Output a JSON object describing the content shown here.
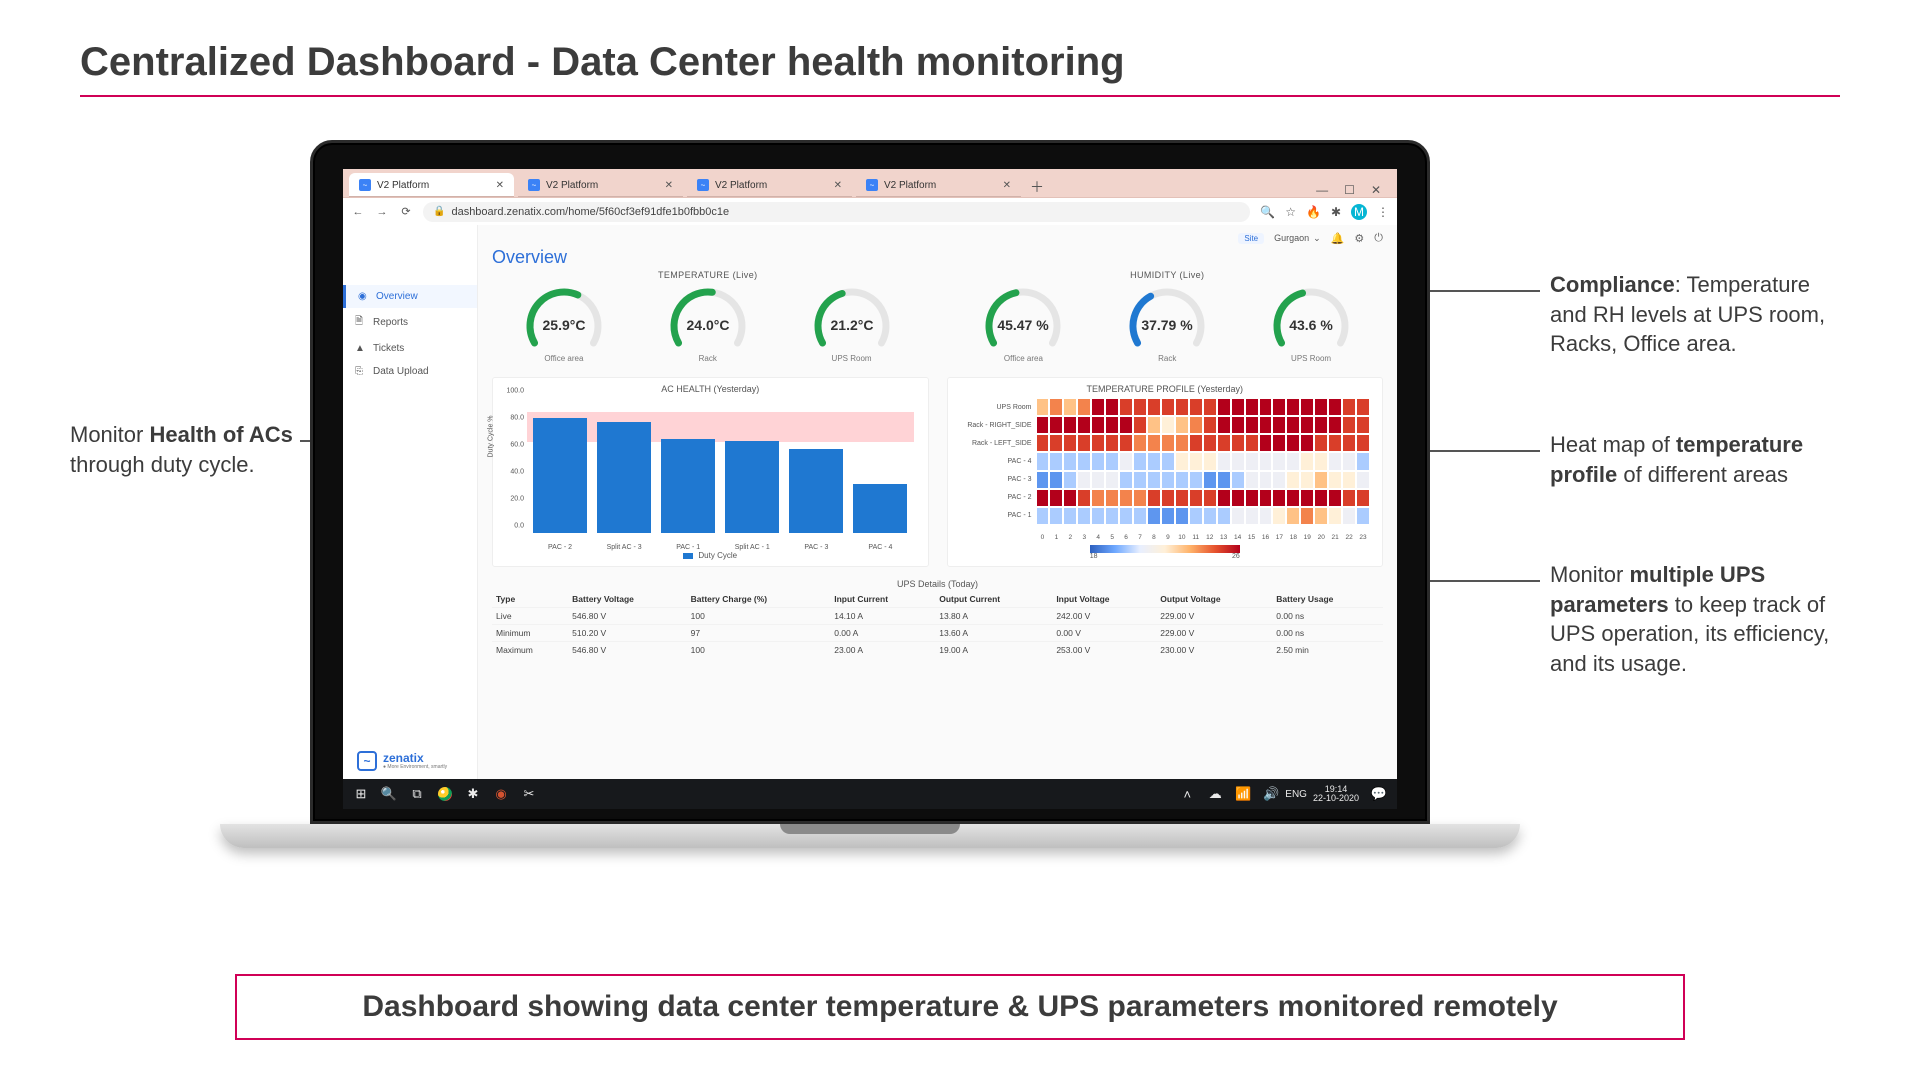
{
  "slide_title": "Centralized Dashboard - Data Center health monitoring",
  "caption": "Dashboard showing data center temperature & UPS parameters monitored remotely",
  "annotations": {
    "compliance": "Compliance",
    "compliance_rest": ": Temperature and RH levels at UPS room, Racks, Office area.",
    "heatmap": "Heat map of ",
    "heatmap_bold": "temperature profile",
    "heatmap_rest": " of different areas",
    "ups": "Monitor ",
    "ups_bold": "multiple UPS parameters",
    "ups_rest": " to keep track of UPS operation, its efficiency, and its usage.",
    "ac": "Monitor ",
    "ac_bold": "Health of ACs",
    "ac_rest": " through duty cycle."
  },
  "browser": {
    "tabs": [
      "V2 Platform",
      "V2 Platform",
      "V2 Platform",
      "V2 Platform"
    ],
    "url": "dashboard.zenatix.com/home/5f60cf3ef91dfe1b0fbb0c1e",
    "avatar_letter": "M"
  },
  "sidebar": {
    "items": [
      {
        "icon": "◉",
        "label": "Overview"
      },
      {
        "icon": "🗎",
        "label": "Reports"
      },
      {
        "icon": "▲",
        "label": "Tickets"
      },
      {
        "icon": "⎘",
        "label": "Data Upload"
      }
    ],
    "brand": "zenatix",
    "brand_sub": "● More Environment, smartly"
  },
  "header": {
    "site": "Site",
    "location": "Gurgaon",
    "title": "Overview"
  },
  "gauges": {
    "group_a_title": "TEMPERATURE (Live)",
    "group_b_title": "HUMIDITY (Live)",
    "a": [
      {
        "value": "25.9°C",
        "label": "Office area",
        "color": "#23a24d",
        "pct": 0.6
      },
      {
        "value": "24.0°C",
        "label": "Rack",
        "color": "#23a24d",
        "pct": 0.53
      },
      {
        "value": "21.2°C",
        "label": "UPS Room",
        "color": "#23a24d",
        "pct": 0.43
      }
    ],
    "b": [
      {
        "value": "45.47 %",
        "label": "Office area",
        "color": "#23a24d",
        "pct": 0.45
      },
      {
        "value": "37.79 %",
        "label": "Rack",
        "color": "#1f78d1",
        "pct": 0.38
      },
      {
        "value": "43.6 %",
        "label": "UPS Room",
        "color": "#23a24d",
        "pct": 0.44
      }
    ]
  },
  "chart_data": [
    {
      "type": "bar",
      "title": "AC HEALTH (Yesterday)",
      "ylabel": "Duty Cycle %",
      "ylim": [
        0,
        100
      ],
      "yticks": [
        0,
        20,
        40,
        60,
        80,
        100
      ],
      "categories": [
        "PAC - 2",
        "Split AC - 3",
        "PAC - 1",
        "Split AC - 1",
        "PAC - 3",
        "PAC - 4"
      ],
      "values": [
        85,
        82,
        70,
        68,
        62,
        36
      ],
      "legend": "Duty Cycle",
      "annotation_band": [
        80,
        100
      ]
    },
    {
      "type": "heatmap",
      "title": "TEMPERATURE PROFILE (Yesterday)",
      "x": [
        0,
        1,
        2,
        3,
        4,
        5,
        6,
        7,
        8,
        9,
        10,
        11,
        12,
        13,
        14,
        15,
        16,
        17,
        18,
        19,
        20,
        21,
        22,
        23
      ],
      "y": [
        "UPS Room",
        "Rack - RIGHT_SIDE",
        "Rack - LEFT_SIDE",
        "PAC - 4",
        "PAC - 3",
        "PAC - 2",
        "PAC - 1"
      ],
      "colorbar_labels": [
        "18",
        "26"
      ],
      "z": [
        [
          23,
          24,
          23,
          24,
          26,
          26,
          25,
          25,
          25,
          25,
          25,
          25,
          25,
          26,
          26,
          26,
          26,
          26,
          26,
          26,
          26,
          26,
          25,
          25
        ],
        [
          26,
          26,
          26,
          26,
          26,
          26,
          26,
          25,
          23,
          22,
          23,
          24,
          25,
          26,
          26,
          26,
          26,
          26,
          26,
          26,
          26,
          26,
          25,
          25
        ],
        [
          25,
          25,
          25,
          25,
          25,
          25,
          25,
          24,
          24,
          24,
          24,
          25,
          25,
          25,
          25,
          25,
          26,
          26,
          26,
          26,
          25,
          25,
          25,
          25
        ],
        [
          20,
          20,
          20,
          20,
          20,
          20,
          21,
          20,
          20,
          20,
          22,
          22,
          22,
          21,
          21,
          21,
          21,
          21,
          21,
          22,
          22,
          21,
          21,
          20
        ],
        [
          19,
          19,
          20,
          21,
          21,
          21,
          20,
          20,
          20,
          20,
          20,
          20,
          19,
          19,
          20,
          21,
          21,
          21,
          22,
          22,
          23,
          22,
          22,
          21
        ],
        [
          26,
          26,
          26,
          25,
          24,
          24,
          24,
          24,
          25,
          25,
          25,
          25,
          25,
          26,
          26,
          26,
          26,
          26,
          26,
          26,
          26,
          26,
          25,
          25
        ],
        [
          20,
          20,
          20,
          20,
          20,
          20,
          20,
          20,
          19,
          19,
          19,
          20,
          20,
          20,
          21,
          21,
          21,
          22,
          23,
          24,
          23,
          22,
          21,
          20
        ]
      ]
    }
  ],
  "ups": {
    "title": "UPS Details (Today)",
    "headers": [
      "Type",
      "Battery Voltage",
      "Battery Charge (%)",
      "Input Current",
      "Output Current",
      "Input Voltage",
      "Output Voltage",
      "Battery Usage"
    ],
    "rows": [
      [
        "Live",
        "546.80 V",
        "100",
        "14.10 A",
        "13.80 A",
        "242.00 V",
        "229.00 V",
        "0.00 ns"
      ],
      [
        "Minimum",
        "510.20 V",
        "97",
        "0.00 A",
        "13.60 A",
        "0.00 V",
        "229.00 V",
        "0.00 ns"
      ],
      [
        "Maximum",
        "546.80 V",
        "100",
        "23.00 A",
        "19.00 A",
        "253.00 V",
        "230.00 V",
        "2.50 min"
      ]
    ]
  },
  "taskbar": {
    "time": "19:14",
    "date": "22-10-2020",
    "lang": "ENG"
  }
}
